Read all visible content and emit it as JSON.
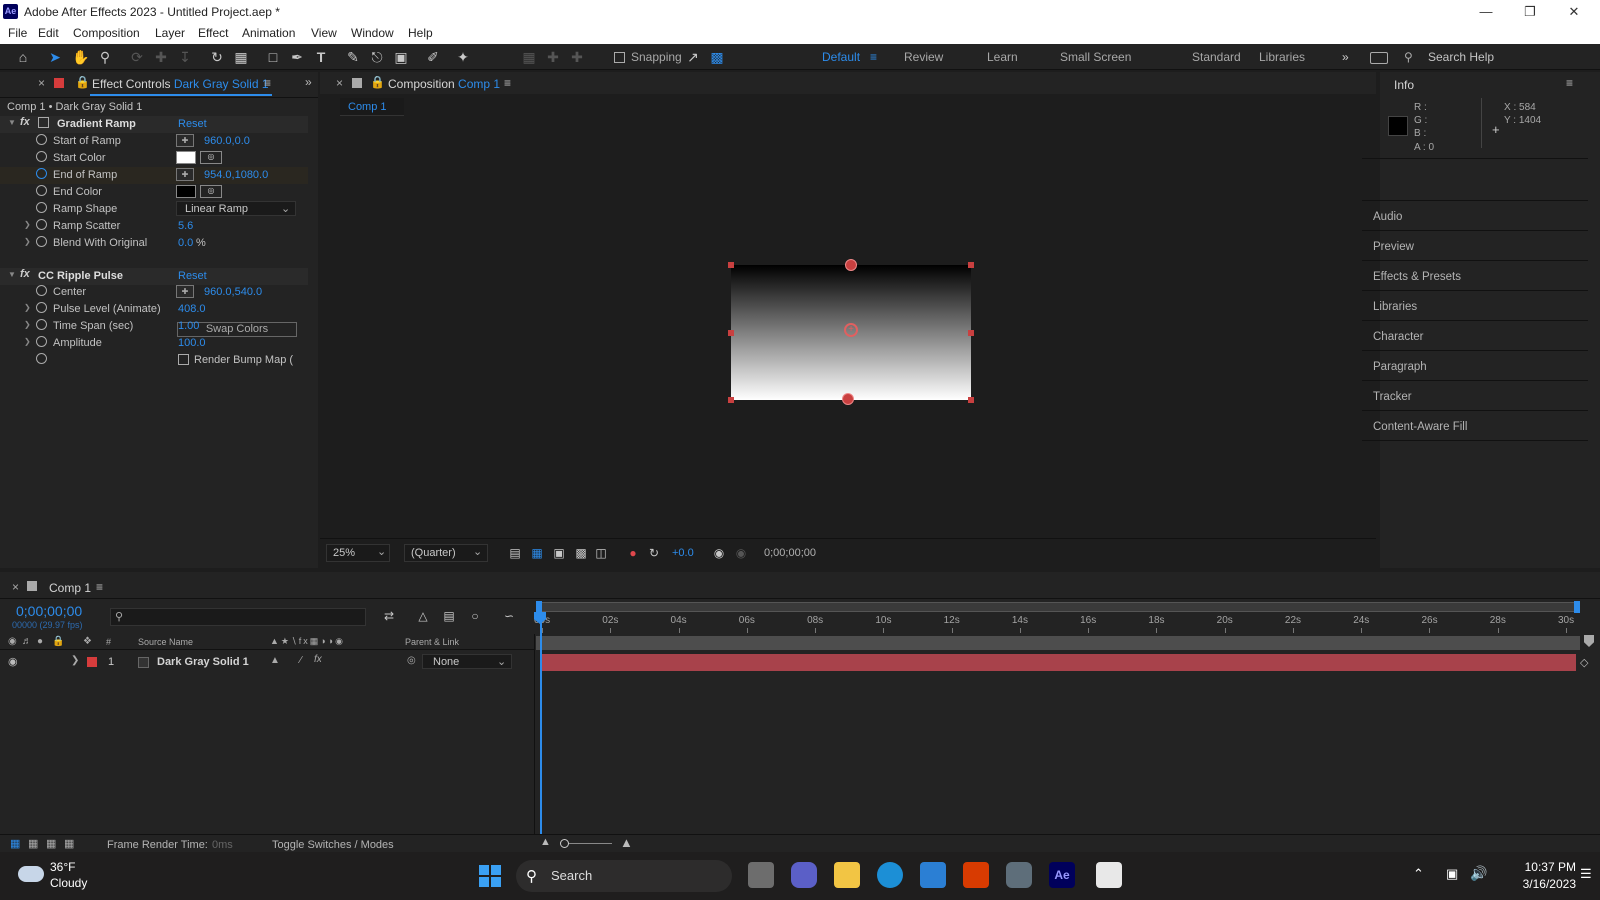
{
  "window": {
    "title": "Adobe After Effects 2023 - Untitled Project.aep *",
    "app_badge": "Ae"
  },
  "menu": [
    "File",
    "Edit",
    "Composition",
    "Layer",
    "Effect",
    "Animation",
    "View",
    "Window",
    "Help"
  ],
  "toolbar": {
    "snapping_label": "Snapping",
    "workspaces": [
      "Default",
      "Review",
      "Learn",
      "Small Screen",
      "Standard",
      "Libraries"
    ],
    "search_placeholder": "Search Help"
  },
  "effect_controls": {
    "tab_label": "Effect Controls",
    "tab_layer": "Dark Gray Solid 1",
    "breadcrumb": "Comp 1 • Dark Gray Solid 1",
    "effects": [
      {
        "name": "Gradient Ramp",
        "reset": "Reset",
        "props": [
          {
            "label": "Start of Ramp",
            "value": "960.0,0.0",
            "kind": "point"
          },
          {
            "label": "Start Color",
            "value": "",
            "kind": "color",
            "color": "#ffffff"
          },
          {
            "label": "End of Ramp",
            "value": "954.0,1080.0",
            "kind": "point"
          },
          {
            "label": "End Color",
            "value": "",
            "kind": "color",
            "color": "#000000"
          },
          {
            "label": "Ramp Shape",
            "value": "Linear Ramp",
            "kind": "select"
          },
          {
            "label": "Ramp Scatter",
            "value": "5.6",
            "kind": "number"
          },
          {
            "label": "Blend With Original",
            "value": "0.0",
            "unit": "%",
            "kind": "number"
          }
        ],
        "button": "Swap Colors"
      },
      {
        "name": "CC Ripple Pulse",
        "reset": "Reset",
        "props": [
          {
            "label": "Center",
            "value": "960.0,540.0",
            "kind": "point"
          },
          {
            "label": "Pulse Level (Animate)",
            "value": "408.0",
            "kind": "number"
          },
          {
            "label": "Time Span (sec)",
            "value": "1.00",
            "kind": "number"
          },
          {
            "label": "Amplitude",
            "value": "100.0",
            "kind": "number"
          }
        ],
        "checkbox": "Render Bump Map ("
      }
    ]
  },
  "composition": {
    "tab_label": "Composition",
    "tab_comp": "Comp 1",
    "subtab": "Comp 1",
    "zoom": "25%",
    "quality": "(Quarter)",
    "exposure": "+0.0",
    "timecode": "0;00;00;00"
  },
  "info": {
    "title": "Info",
    "r": "R :",
    "g": "G :",
    "b": "B :",
    "a": "A : 0",
    "x": "X : 584",
    "y": "Y : 1404"
  },
  "right_panels": [
    "Audio",
    "Preview",
    "Effects & Presets",
    "Libraries",
    "Character",
    "Paragraph",
    "Tracker",
    "Content-Aware Fill"
  ],
  "timeline": {
    "tab": "Comp 1",
    "timecode": "0;00;00;00",
    "fps": "00000 (29.97 fps)",
    "col_num": "#",
    "col_source": "Source Name",
    "col_parent": "Parent & Link",
    "layer": {
      "num": "1",
      "name": "Dark Gray Solid 1",
      "parent": "None"
    },
    "ticks": [
      "00s",
      "02s",
      "04s",
      "06s",
      "08s",
      "10s",
      "12s",
      "14s",
      "16s",
      "18s",
      "20s",
      "22s",
      "24s",
      "26s",
      "28s",
      "30s"
    ],
    "footer_render_label": "Frame Render Time:",
    "footer_render_value": "0ms",
    "footer_toggle": "Toggle Switches / Modes"
  },
  "taskbar": {
    "weather_temp": "36°F",
    "weather_desc": "Cloudy",
    "search": "Search",
    "time": "10:37 PM",
    "date": "3/16/2023"
  }
}
